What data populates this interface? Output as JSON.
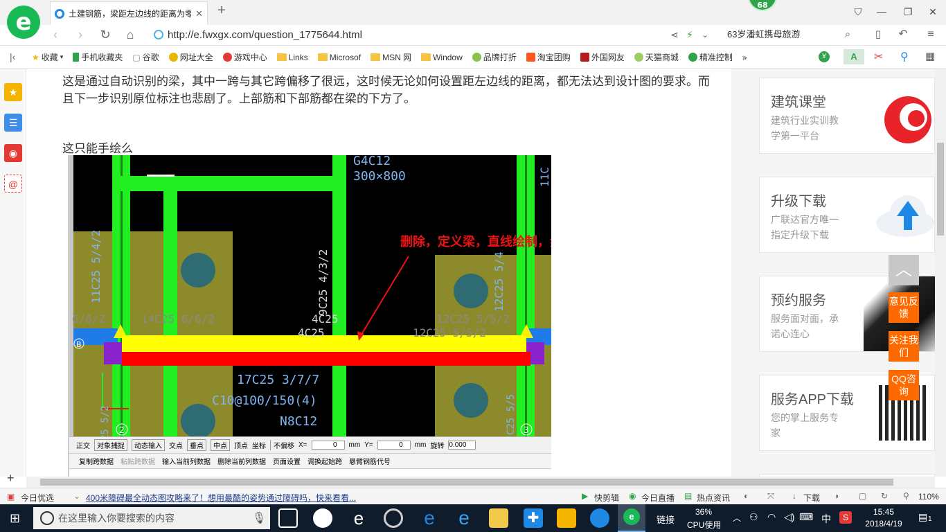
{
  "browser": {
    "tab_title": "土建钢筋，梁距左边线的距离为零",
    "new_tab": "+",
    "badge_count": "68",
    "url": "http://e.fwxgx.com/question_1775644.html",
    "search_text": "63岁潘虹携母旅游",
    "bookmarks": [
      "收藏",
      "手机收藏夹",
      "谷歌",
      "网址大全",
      "游戏中心",
      "Links",
      "Microsof",
      "MSN 网",
      "Window",
      "品牌打折",
      "淘宝团购",
      "外国网友",
      "天猫商城",
      "精准控制"
    ],
    "more": "»"
  },
  "article": {
    "para1": "这是通过自动识别的梁，其中一跨与其它跨偏移了很远，这时候无论如何设置距左边线的距离，都无法达到设计图的要求。而且下一步识别原位标注也悲剧了。上部筋和下部筋都在梁的下方了。",
    "para2": "这只能手绘么"
  },
  "cad": {
    "annotation": "删除，定义梁，直线绘制，然后使用单对齐",
    "labels": {
      "g4": "G4C12",
      "size": "300×800",
      "l11c": "11C",
      "v1": "11C25 5/4/2",
      "v2": "9C25 4/3/2",
      "v3": "12C25 5/4",
      "h1": "6/6/2",
      "h2": "14C25 6/6/2",
      "h3": "4C25",
      "h4": "12C25 5/5/2",
      "h5": "12C25 5/5/2",
      "h6": "4C25",
      "b1": "17C25 3/7/7",
      "b2": "C10@100/150(4)",
      "b3": "N8C12",
      "num2": "2",
      "num3": "3",
      "vb": "25 5/2",
      "vb2": "C25 5/5",
      "bl": "B"
    },
    "toolbar1": [
      "正交",
      "对象捕捉",
      "动态输入",
      "交点",
      "垂点",
      "中点",
      "顶点",
      "坐标",
      "不偏移",
      "X=",
      "0",
      "mm",
      "Y=",
      "0",
      "mm",
      "旋转",
      "0.000"
    ],
    "toolbar2": [
      "复制跨数据",
      "粘贴跨数据",
      "输入当前列数据",
      "删除当前列数据",
      "页面设置",
      "调换起始跨",
      "悬臂钢筋代号"
    ]
  },
  "right": {
    "cards": [
      {
        "title": "建筑课堂",
        "desc": "建筑行业实训教学第一平台"
      },
      {
        "title": "升级下载",
        "desc": "广联达官方唯一指定升级下载"
      },
      {
        "title": "预约服务",
        "desc": "服务面对面，承诺心连心"
      },
      {
        "title": "服务APP下载",
        "desc": "您的掌上服务专家"
      }
    ],
    "float": [
      "意见反馈",
      "关注我们",
      "QQ咨询"
    ]
  },
  "status": {
    "left": "今日优选",
    "news": "400米障碍最全动态图攻略来了！想用最酷的姿势通过障碍吗，快来看看...",
    "items": [
      "快剪辑",
      "今日直播",
      "热点资讯",
      "下载"
    ],
    "zoom": "110%"
  },
  "taskbar": {
    "search": "在这里输入你要搜索的内容",
    "link": "链接",
    "cpu_pct": "36%",
    "cpu_label": "CPU使用",
    "ime": "中",
    "time": "15:45",
    "date": "2018/4/19",
    "notif": "1"
  }
}
